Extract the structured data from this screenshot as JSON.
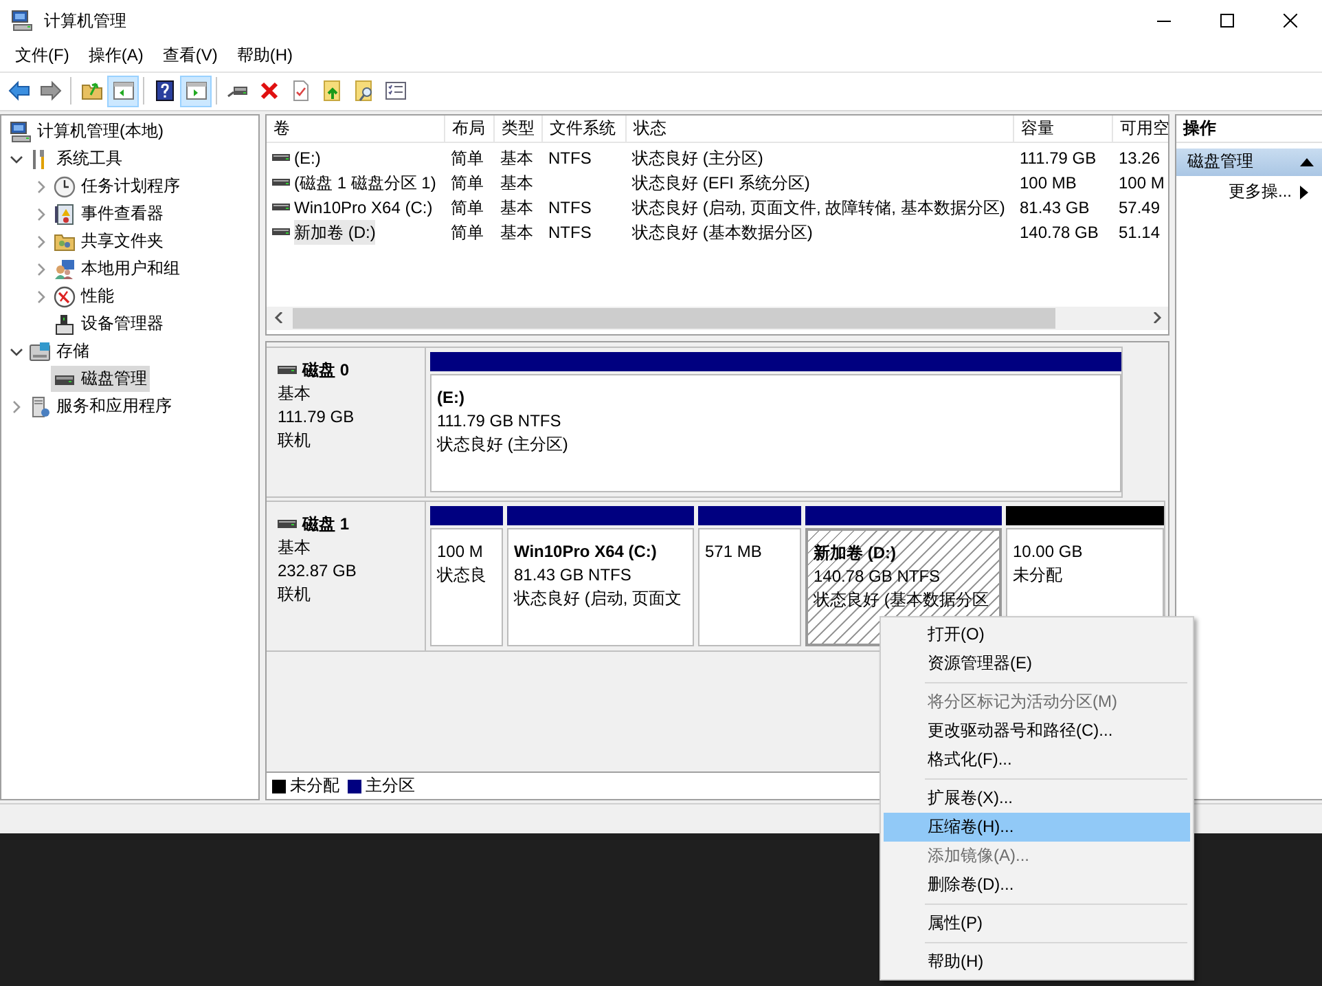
{
  "window": {
    "title": "计算机管理"
  },
  "menu_bar": [
    "文件(F)",
    "操作(A)",
    "查看(V)",
    "帮助(H)"
  ],
  "toolbar": [
    [
      {
        "kind": "back",
        "pressed": false
      },
      {
        "kind": "forward",
        "pressed": false
      }
    ],
    [
      {
        "kind": "up-folder",
        "pressed": false
      },
      {
        "kind": "console-tree",
        "pressed": true
      }
    ],
    [
      {
        "kind": "help",
        "pressed": false
      },
      {
        "kind": "action-pane",
        "pressed": true
      }
    ],
    [
      {
        "kind": "drive",
        "pressed": false
      },
      {
        "kind": "delete",
        "pressed": false
      },
      {
        "kind": "check-page",
        "pressed": false
      },
      {
        "kind": "arrow-page",
        "pressed": false
      },
      {
        "kind": "search-page",
        "pressed": false
      },
      {
        "kind": "properties",
        "pressed": false
      }
    ]
  ],
  "tree": [
    {
      "label": "计算机管理(本地)",
      "kind": "computer",
      "selected": false,
      "children": [
        {
          "label": "系统工具",
          "kind": "tools",
          "expanded": true,
          "selected": false,
          "children": [
            {
              "label": "任务计划程序",
              "kind": "clock",
              "expanded": false,
              "selected": false
            },
            {
              "label": "事件查看器",
              "kind": "log",
              "expanded": false,
              "selected": false
            },
            {
              "label": "共享文件夹",
              "kind": "share",
              "expanded": false,
              "selected": false
            },
            {
              "label": "本地用户和组",
              "kind": "users",
              "expanded": false,
              "selected": false
            },
            {
              "label": "性能",
              "kind": "gauge",
              "expanded": false,
              "selected": false
            },
            {
              "label": "设备管理器",
              "kind": "device",
              "selected": false
            }
          ]
        },
        {
          "label": "存储",
          "kind": "storage",
          "expanded": true,
          "selected": false,
          "children": [
            {
              "label": "磁盘管理",
              "kind": "disk",
              "selected": true
            }
          ]
        },
        {
          "label": "服务和应用程序",
          "kind": "services",
          "expanded": false,
          "selected": false
        }
      ]
    }
  ],
  "volume_table": {
    "columns": [
      "卷",
      "布局",
      "类型",
      "文件系统",
      "状态",
      "容量",
      "可用空"
    ],
    "rows": [
      {
        "volume": " (E:)",
        "layout": "简单",
        "type": "基本",
        "file_system": "NTFS",
        "status": "状态良好 (主分区)",
        "capacity": "111.79 GB",
        "column_7": "13.26",
        "selected": false
      },
      {
        "volume": "(磁盘 1 磁盘分区 1)",
        "layout": "简单",
        "type": "基本",
        "status": "状态良好 (EFI 系统分区)",
        "capacity": "100 MB",
        "column_7": "100 M",
        "selected": false
      },
      {
        "volume": "Win10Pro X64 (C:)",
        "layout": "简单",
        "type": "基本",
        "file_system": "NTFS",
        "status": "状态良好 (启动, 页面文件, 故障转储, 基本数据分区)",
        "capacity": "81.43 GB",
        "column_7": "57.49",
        "selected": false
      },
      {
        "volume": "新加卷 (D:)",
        "layout": "简单",
        "type": "基本",
        "file_system": "NTFS",
        "status": "状态良好 (基本数据分区)",
        "capacity": "140.78 GB",
        "column_7": "51.14",
        "selected": true
      }
    ]
  },
  "disks": [
    {
      "name": "磁盘 0",
      "type": "基本",
      "size": "111.79 GB",
      "state": "联机",
      "partitions": [
        {
          "kind": "primary",
          "title": "(E:)",
          "lines": [
            "111.79 GB NTFS",
            "状态良好 (主分区)"
          ],
          "selected": false
        }
      ]
    },
    {
      "name": "磁盘 1",
      "type": "基本",
      "size": "232.87 GB",
      "state": "联机",
      "partitions": [
        {
          "kind": "primary",
          "lines": [
            "100 M",
            "状态良"
          ],
          "selected": false
        },
        {
          "kind": "primary",
          "title": "Win10Pro X64  (C:)",
          "lines": [
            "81.43 GB NTFS",
            "状态良好 (启动, 页面文"
          ],
          "selected": false
        },
        {
          "kind": "primary",
          "lines": [
            "571 MB"
          ],
          "selected": false
        },
        {
          "kind": "primary",
          "title": "新加卷  (D:)",
          "lines": [
            "140.78 GB NTFS",
            "状态良好 (基本数据分区"
          ],
          "selected": true
        },
        {
          "kind": "unallocated",
          "lines": [
            "10.00 GB",
            "未分配"
          ],
          "selected": false
        }
      ]
    }
  ],
  "legend": [
    {
      "kind": "unallocated",
      "label": "未分配",
      "color": "#000000"
    },
    {
      "kind": "primary",
      "label": "主分区",
      "color": "#000080"
    }
  ],
  "actions": {
    "header": "操作",
    "section": {
      "label": "磁盘管理",
      "expanded": true
    },
    "items": [
      {
        "label": "更多操...",
        "submenu": true
      }
    ]
  },
  "context_menu": {
    "groups": [
      [
        {
          "label": "打开(O)",
          "disabled": false,
          "selected": false
        },
        {
          "label": "资源管理器(E)",
          "disabled": false,
          "selected": false
        }
      ],
      [
        {
          "label": "将分区标记为活动分区(M)",
          "disabled": true,
          "selected": false
        },
        {
          "label": "更改驱动器号和路径(C)...",
          "disabled": false,
          "selected": false
        },
        {
          "label": "格式化(F)...",
          "disabled": false,
          "selected": false
        }
      ],
      [
        {
          "label": "扩展卷(X)...",
          "disabled": false,
          "selected": false
        },
        {
          "label": "压缩卷(H)...",
          "disabled": false,
          "selected": true
        },
        {
          "label": "添加镜像(A)...",
          "disabled": true,
          "selected": false
        },
        {
          "label": "删除卷(D)...",
          "disabled": false,
          "selected": false
        }
      ],
      [
        {
          "label": "属性(P)",
          "disabled": false,
          "selected": false
        }
      ],
      [
        {
          "label": "帮助(H)",
          "disabled": false,
          "selected": false
        }
      ]
    ]
  }
}
